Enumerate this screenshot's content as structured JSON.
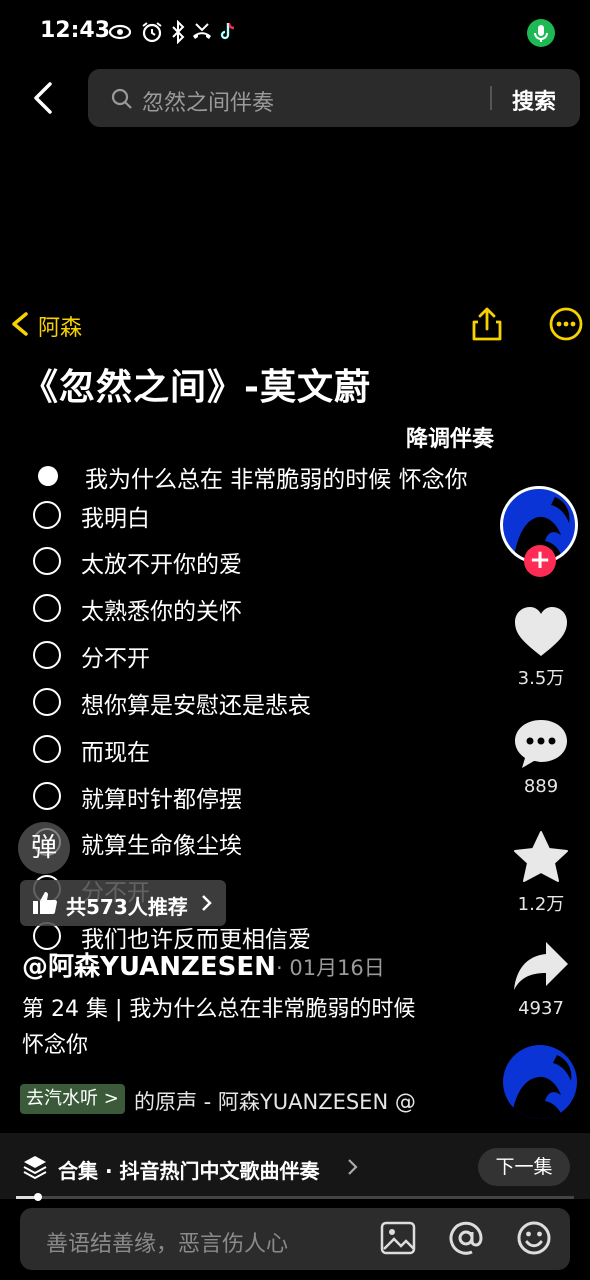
{
  "status_bar": {
    "time": "12:43"
  },
  "search": {
    "query": "忽然之间伴奏",
    "button": "搜索"
  },
  "author": {
    "name": "阿森"
  },
  "post": {
    "title": "《忽然之间》-莫文蔚",
    "subtitle": "降调伴奏",
    "lyrics": [
      "我为什么总在 非常脆弱的时候 怀念你",
      "我明白",
      "太放不开你的爱",
      "太熟悉你的关怀",
      "分不开",
      "想你算是安慰还是悲哀",
      "而现在",
      "就算时针都停摆",
      "就算生命像尘埃",
      "分不开",
      "我们也许反而更相信爱"
    ]
  },
  "actions": {
    "likes": "3.5万",
    "comments": "889",
    "favorites": "1.2万",
    "shares": "4937"
  },
  "danmaku": {
    "label": "弹"
  },
  "recommend": {
    "text": "共573人推荐"
  },
  "info": {
    "handle": "@阿森YUANZESEN",
    "date": "· 01月16日",
    "description": "第 24 集 | 我为什么总在非常脆弱的时候 怀念你",
    "music_tag": "去汽水听 >",
    "music": "的原声 - 阿森YUANZESEN   @"
  },
  "collection": {
    "text": "合集 · 抖音热门中文歌曲伴奏",
    "next": "下一集"
  },
  "comment_input": {
    "placeholder": "善语结善缘，恶言伤人心"
  },
  "colors": {
    "accent_yellow": "#f7d100",
    "follow_red": "#fe2c55",
    "mic_green": "#1db954"
  }
}
